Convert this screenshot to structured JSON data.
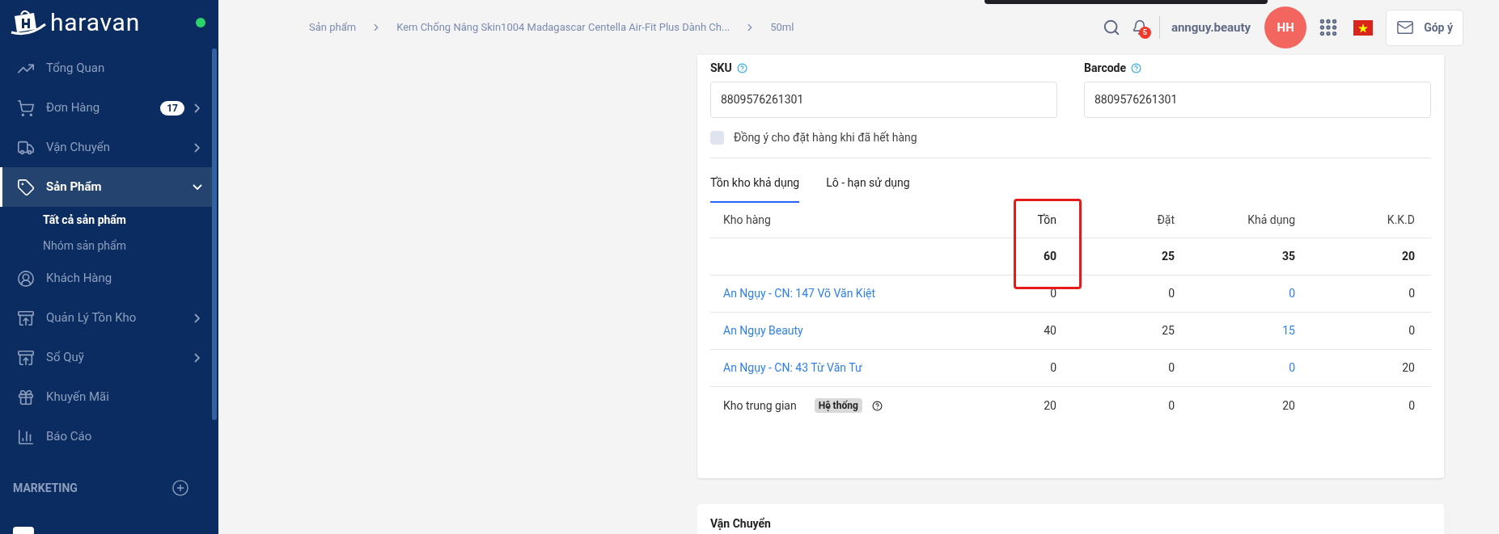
{
  "sidebar": {
    "brand": "haravan",
    "online": true,
    "items": [
      {
        "label": "Tổng Quan",
        "kind": "chart",
        "selected": false
      },
      {
        "label": "Đơn Hàng",
        "kind": "cart",
        "badge": "17",
        "expanded": false,
        "selected": false
      },
      {
        "label": "Vận Chuyển",
        "kind": "truck",
        "expanded": false,
        "selected": false
      },
      {
        "label": "Sản Phẩm",
        "kind": "tag",
        "expanded": true,
        "selected": true,
        "children": [
          {
            "label": "Tất cả sản phẩm",
            "selected": true
          },
          {
            "label": "Nhóm sản phẩm",
            "selected": false
          }
        ]
      },
      {
        "label": "Khách Hàng",
        "kind": "user",
        "selected": false
      },
      {
        "label": "Quản Lý Tồn Kho",
        "kind": "box",
        "expanded": false,
        "selected": false
      },
      {
        "label": "Sổ Quỹ",
        "kind": "box",
        "expanded": false,
        "selected": false
      },
      {
        "label": "Khuyến Mãi",
        "kind": "gift",
        "selected": false
      },
      {
        "label": "Báo Cáo",
        "kind": "report",
        "selected": false
      }
    ],
    "section": "MARKETING"
  },
  "breadcrumb": [
    "Sản phẩm",
    "Kem Chống Nắng Skin1004 Madagascar Centella Air-Fit Plus Dành Ch...",
    "50ml"
  ],
  "topbar": {
    "notifications": "5",
    "store": "annguy.beauty",
    "avatar": "HH",
    "feedback": "Góp ý"
  },
  "fields": [
    {
      "label": "SKU",
      "value": "8809576261301"
    },
    {
      "label": "Barcode",
      "value": "8809576261301"
    }
  ],
  "backorder": {
    "label": "Đồng ý cho đặt hàng khi đã hết hàng",
    "checked": false
  },
  "tabs": [
    {
      "label": "Tồn kho khả dụng",
      "selected": true
    },
    {
      "label": "Lô - hạn sử dụng",
      "selected": false
    }
  ],
  "table": {
    "columns": [
      {
        "label": "Kho hàng",
        "highlighted": false
      },
      {
        "label": "Tồn",
        "highlighted": true
      },
      {
        "label": "Đặt",
        "highlighted": false
      },
      {
        "label": "Khả dụng",
        "highlighted": false
      },
      {
        "label": "K.K.D",
        "highlighted": false
      }
    ],
    "totals": [
      "60",
      "25",
      "35",
      "20"
    ],
    "rows": [
      {
        "name": "An Ngụy - CN: 147 Võ Văn Kiệt",
        "link": true,
        "values": [
          "0",
          "0",
          "0",
          "0"
        ]
      },
      {
        "name": "An Ngụy Beauty",
        "link": true,
        "values": [
          "40",
          "25",
          "15",
          "0"
        ]
      },
      {
        "name": "An Ngụy - CN: 43 Từ Văn Tư",
        "link": true,
        "values": [
          "0",
          "0",
          "0",
          "20"
        ]
      },
      {
        "name": "Kho trung gian",
        "link": false,
        "tag": "Hệ thống",
        "values": [
          "20",
          "0",
          "20",
          "0"
        ]
      }
    ]
  },
  "next_section": "Vận Chuyển"
}
